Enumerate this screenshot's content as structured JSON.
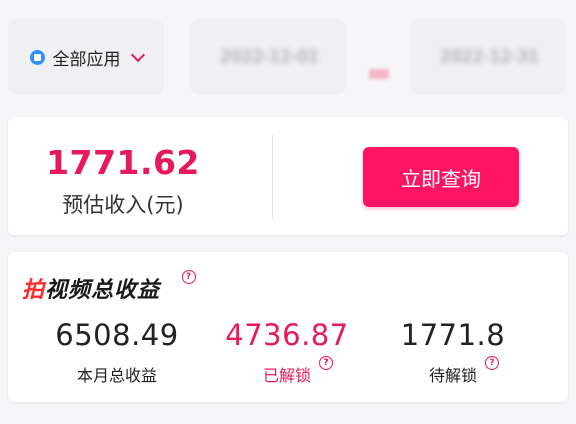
{
  "filters": {
    "app_label": "全部应用",
    "start_date": "2022-12-01",
    "end_date": "2022-12-31",
    "colors": {
      "app_icon": "#2f8fff",
      "accent": "#e8195a"
    }
  },
  "summary": {
    "amount": "1771.62",
    "label": "预估收入(元)",
    "query_button": "立即查询",
    "button_color": "#ff1463"
  },
  "earnings": {
    "title_first_char": "拍",
    "title_rest": "视频总收益",
    "help_glyph": "?",
    "stats": [
      {
        "value": "6508.49",
        "label": "本月总收益"
      },
      {
        "value": "4736.87",
        "label": "已解锁"
      },
      {
        "value": "1771.8",
        "label": "待解锁"
      }
    ]
  }
}
